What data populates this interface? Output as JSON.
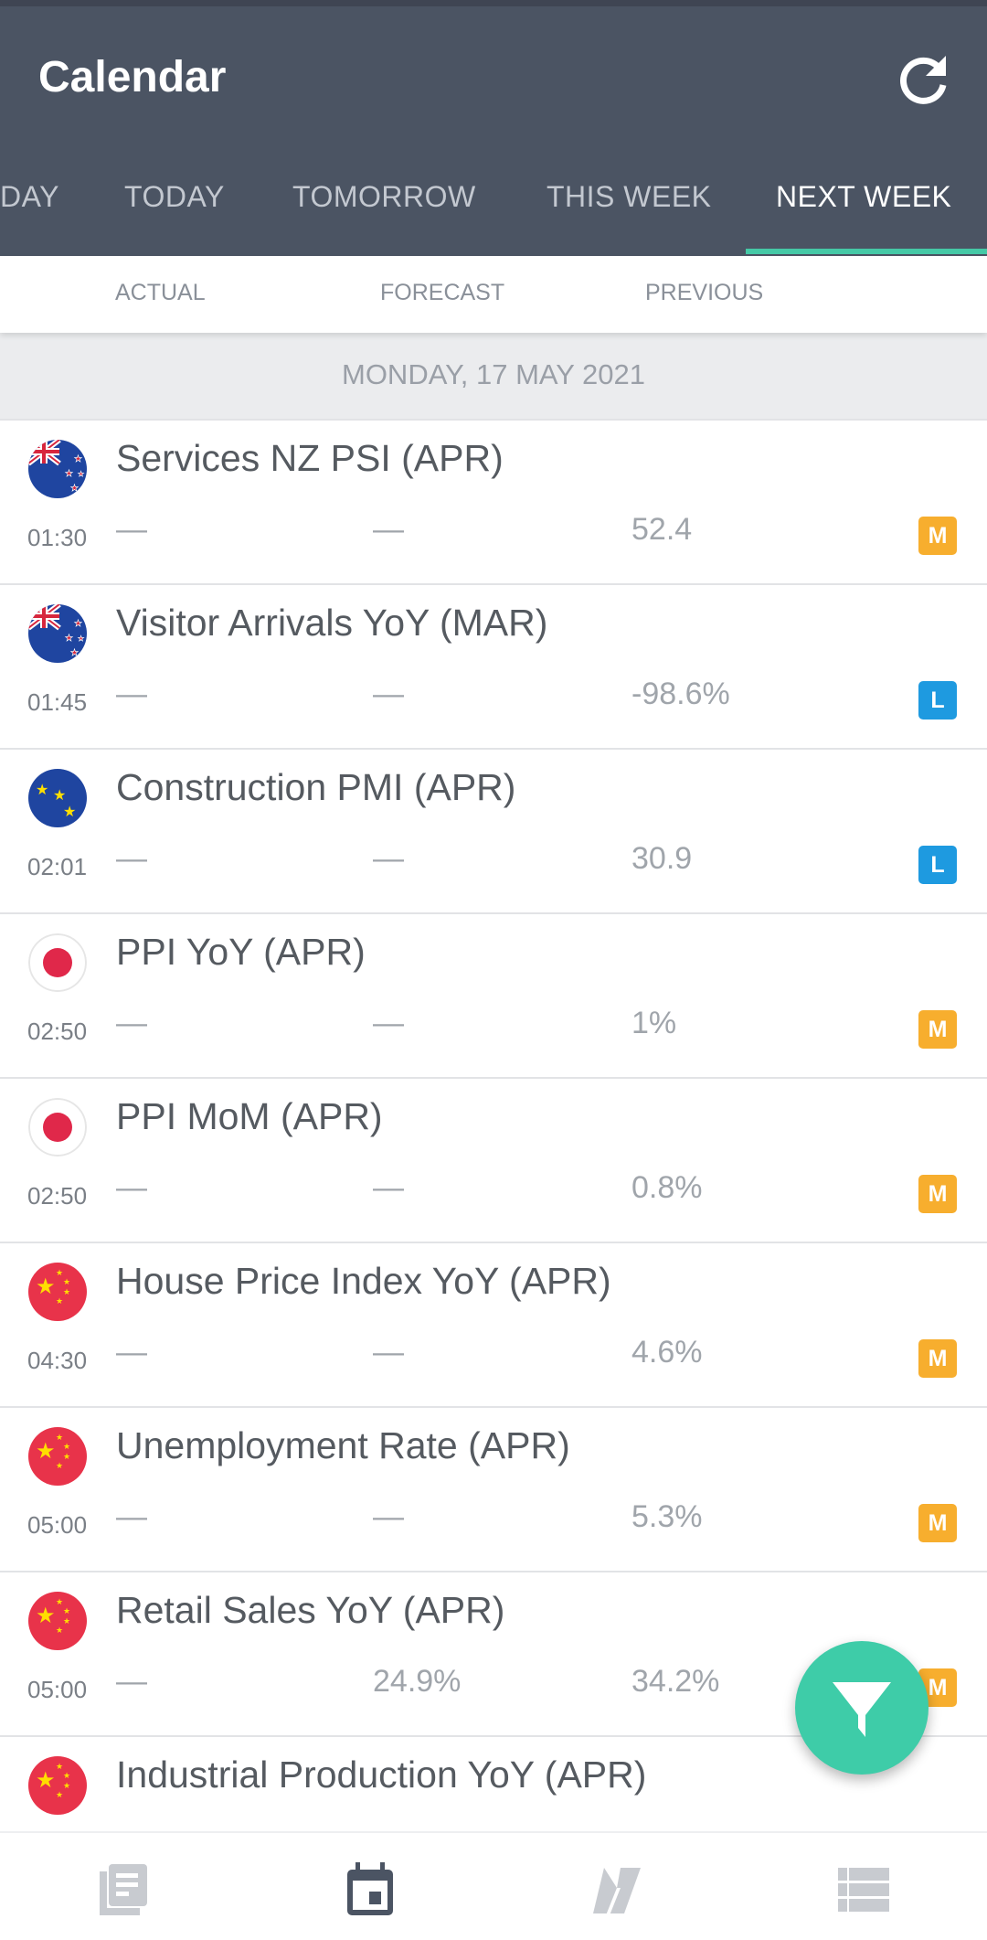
{
  "header": {
    "title": "Calendar",
    "refresh_icon": "refresh-icon"
  },
  "tabs": [
    {
      "label": "DAY",
      "active": false
    },
    {
      "label": "TODAY",
      "active": false
    },
    {
      "label": "TOMORROW",
      "active": false
    },
    {
      "label": "THIS WEEK",
      "active": false
    },
    {
      "label": "NEXT WEEK",
      "active": true
    }
  ],
  "columns": {
    "actual": "ACTUAL",
    "forecast": "FORECAST",
    "previous": "PREVIOUS"
  },
  "colors": {
    "appbar": "#4b5463",
    "accent": "#45c9a6",
    "impact_medium": "#f7ae2e",
    "impact_low": "#1e9ae0",
    "fab": "#3ecca8"
  },
  "day_header": "MONDAY, 17 MAY 2021",
  "events": [
    {
      "country": "NZ",
      "flag": "new-zealand-flag-icon",
      "title": "Services NZ PSI (APR)",
      "time": "01:30",
      "actual": "—",
      "forecast": "—",
      "previous": "52.4",
      "impact": "M"
    },
    {
      "country": "NZ",
      "flag": "new-zealand-flag-icon",
      "title": "Visitor Arrivals YoY (MAR)",
      "time": "01:45",
      "actual": "—",
      "forecast": "—",
      "previous": "-98.6%",
      "impact": "L"
    },
    {
      "country": "EU",
      "flag": "europe-flag-icon",
      "title": "Construction PMI (APR)",
      "time": "02:01",
      "actual": "—",
      "forecast": "—",
      "previous": "30.9",
      "impact": "L"
    },
    {
      "country": "JP",
      "flag": "japan-flag-icon",
      "title": "PPI YoY (APR)",
      "time": "02:50",
      "actual": "—",
      "forecast": "—",
      "previous": "1%",
      "impact": "M"
    },
    {
      "country": "JP",
      "flag": "japan-flag-icon",
      "title": "PPI MoM (APR)",
      "time": "02:50",
      "actual": "—",
      "forecast": "—",
      "previous": "0.8%",
      "impact": "M"
    },
    {
      "country": "CN",
      "flag": "china-flag-icon",
      "title": "House Price Index YoY (APR)",
      "time": "04:30",
      "actual": "—",
      "forecast": "—",
      "previous": "4.6%",
      "impact": "M"
    },
    {
      "country": "CN",
      "flag": "china-flag-icon",
      "title": "Unemployment Rate (APR)",
      "time": "05:00",
      "actual": "—",
      "forecast": "—",
      "previous": "5.3%",
      "impact": "M"
    },
    {
      "country": "CN",
      "flag": "china-flag-icon",
      "title": "Retail Sales YoY (APR)",
      "time": "05:00",
      "actual": "—",
      "forecast": "24.9%",
      "previous": "34.2%",
      "impact": "M"
    },
    {
      "country": "CN",
      "flag": "china-flag-icon",
      "title": "Industrial Production YoY (APR)",
      "time": "",
      "actual": "",
      "forecast": "",
      "previous": "",
      "impact": ""
    }
  ],
  "fab": {
    "icon": "filter-icon"
  },
  "bottom_nav": [
    {
      "icon": "news-icon",
      "active": false
    },
    {
      "icon": "calendar-icon",
      "active": true
    },
    {
      "icon": "hourglass-icon",
      "active": false
    },
    {
      "icon": "list-icon",
      "active": false
    }
  ]
}
